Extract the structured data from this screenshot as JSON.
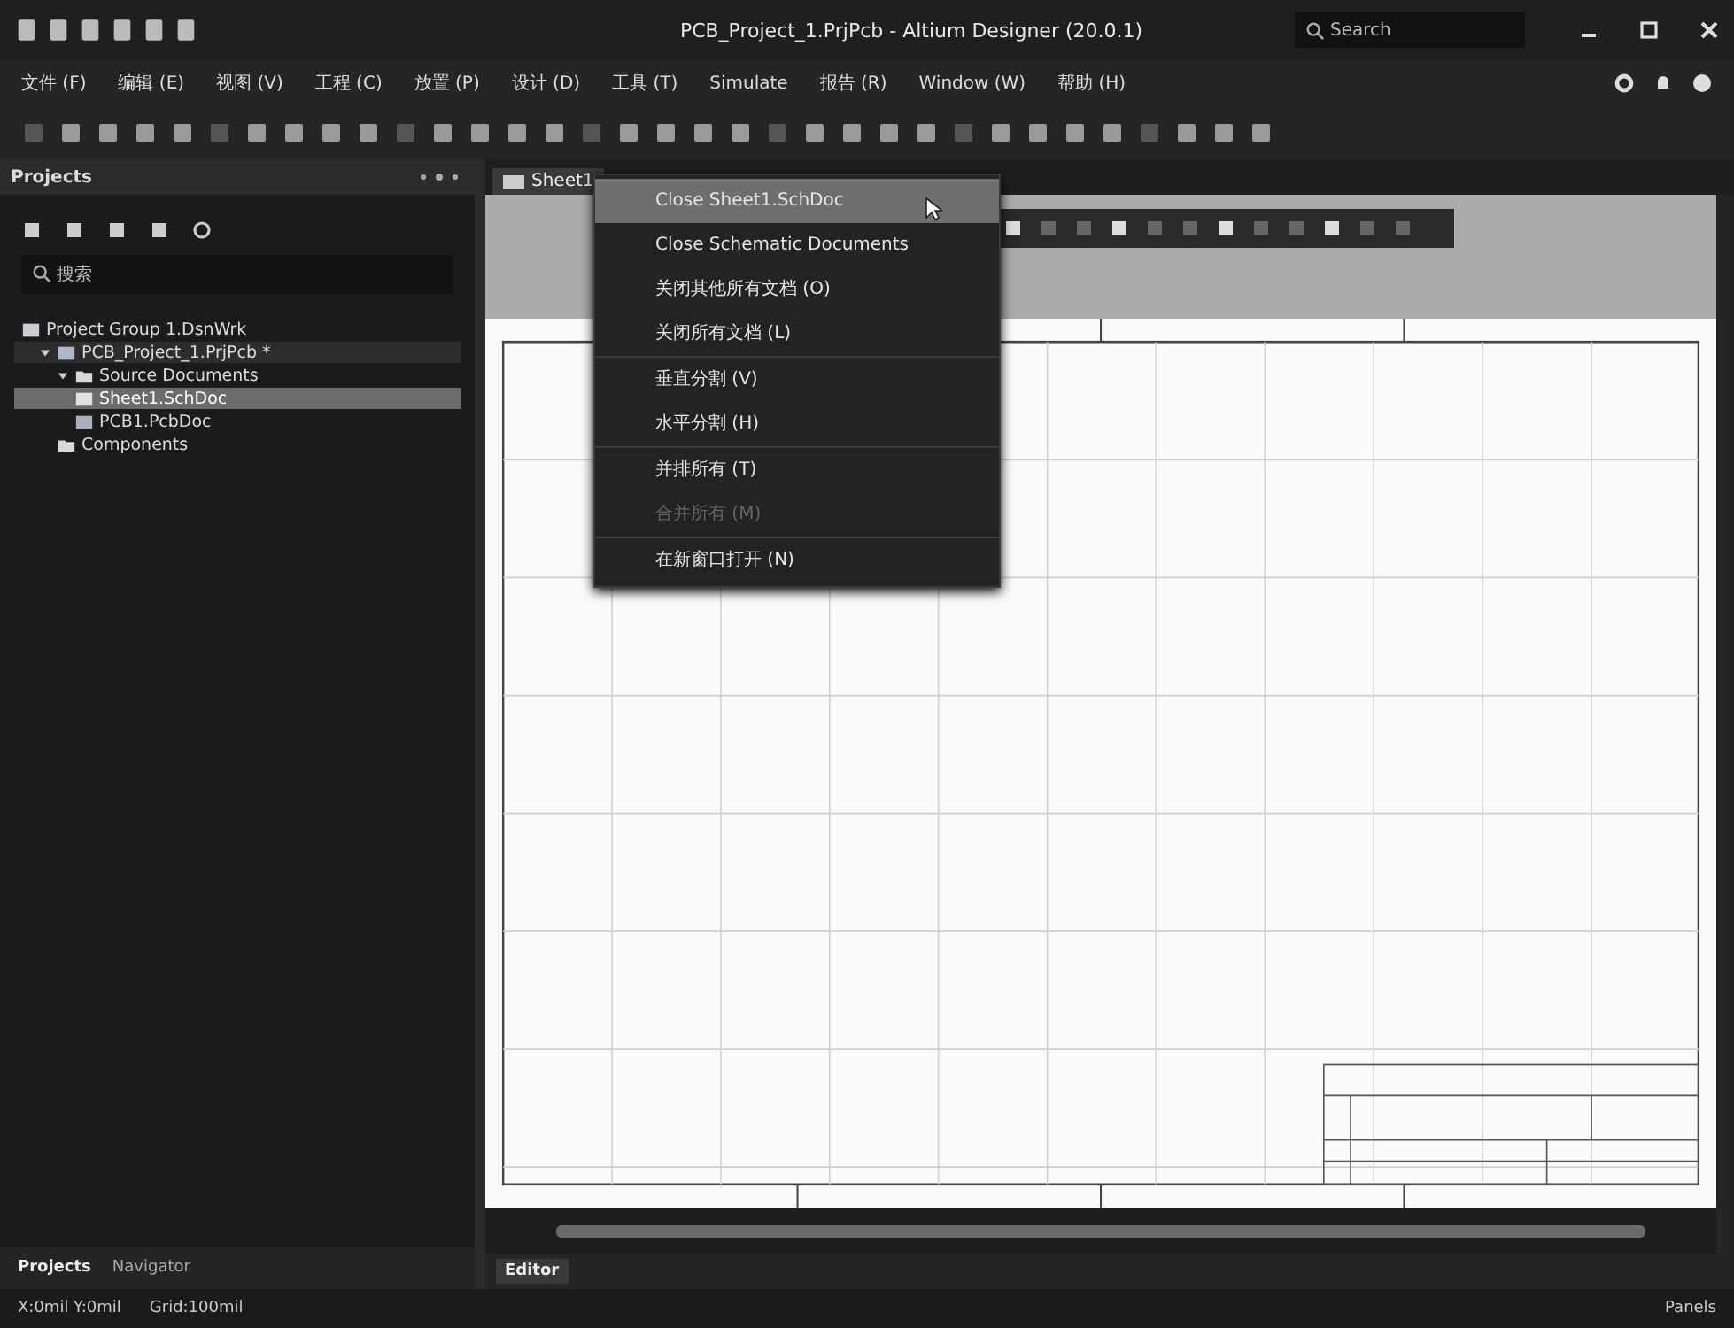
{
  "window": {
    "title": "PCB_Project_1.PrjPcb - Altium Designer (20.0.1)",
    "search": {
      "placeholder": "Search"
    }
  },
  "menu": [
    "文件 (F)",
    "编辑 (E)",
    "视图 (V)",
    "工程 (C)",
    "放置 (P)",
    "设计 (D)",
    "工具 (T)",
    "Simulate",
    "报告 (R)",
    "Window (W)",
    "帮助 (H)"
  ],
  "projects_panel": {
    "title": "Projects",
    "search": {
      "placeholder": "搜索"
    },
    "tree": [
      {
        "label": "Project Group 1.DsnWrk",
        "kind": "group",
        "selected": false,
        "children": [
          {
            "label": "PCB_Project_1.PrjPcb *",
            "kind": "project",
            "selected": false,
            "expanded": true,
            "children": [
              {
                "label": "Source Documents",
                "kind": "folder",
                "selected": false,
                "expanded": true,
                "children": [
                  {
                    "label": "Sheet1.SchDoc",
                    "kind": "sch",
                    "selected": true
                  },
                  {
                    "label": "PCB1.PcbDoc",
                    "kind": "pcb",
                    "selected": false
                  }
                ]
              },
              {
                "label": "Components",
                "kind": "folder",
                "selected": false
              }
            ]
          }
        ]
      }
    ],
    "bottom_tabs": [
      {
        "label": "Projects",
        "selected": true
      },
      {
        "label": "Navigator",
        "selected": false
      }
    ]
  },
  "doc_tabs": [
    {
      "label": "Sheet1",
      "selected": true
    }
  ],
  "context_menu": [
    {
      "label": "Close Sheet1.SchDoc",
      "highlighted": true,
      "disabled": false,
      "separator_after": false
    },
    {
      "label": "Close Schematic Documents",
      "highlighted": false,
      "disabled": false,
      "separator_after": false
    },
    {
      "label": "关闭其他所有文档 (O)",
      "highlighted": false,
      "disabled": false,
      "separator_after": false
    },
    {
      "label": "关闭所有文档 (L)",
      "highlighted": false,
      "disabled": false,
      "separator_after": true
    },
    {
      "label": "垂直分割 (V)",
      "highlighted": false,
      "disabled": false,
      "separator_after": false
    },
    {
      "label": "水平分割 (H)",
      "highlighted": false,
      "disabled": false,
      "separator_after": true
    },
    {
      "label": "并排所有 (T)",
      "highlighted": false,
      "disabled": false,
      "separator_after": false
    },
    {
      "label": "合并所有 (M)",
      "highlighted": false,
      "disabled": true,
      "separator_after": true
    },
    {
      "label": "在新窗口打开 (N)",
      "highlighted": false,
      "disabled": false,
      "separator_after": false
    }
  ],
  "editor_tabs": [
    {
      "label": "Editor",
      "selected": true
    }
  ],
  "status_bar": {
    "coords": "X:0mil Y:0mil",
    "grid": "Grid:100mil",
    "panels": "Panels"
  }
}
